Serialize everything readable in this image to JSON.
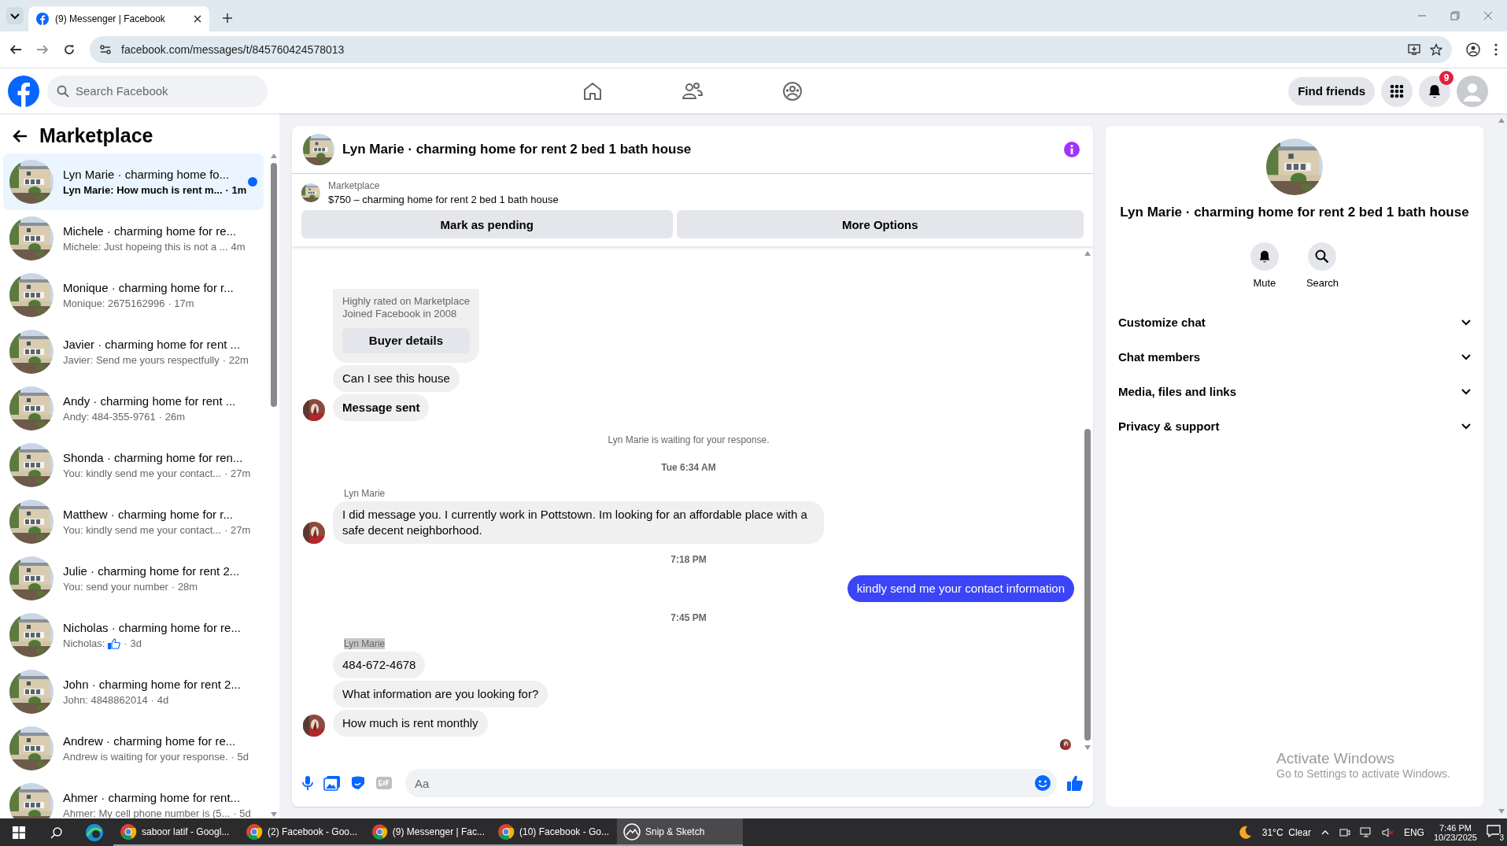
{
  "browser": {
    "tab_title": "(9) Messenger | Facebook",
    "url": "facebook.com/messages/t/845760424578013"
  },
  "header": {
    "search_placeholder": "Search Facebook",
    "find_friends": "Find friends",
    "notification_count": "9"
  },
  "sidebar": {
    "title": "Marketplace",
    "conversations": [
      {
        "title": "Lyn Marie · charming home fo...",
        "preview": "Lyn Marie: How much is rent m...",
        "time": "· 1m",
        "selected": true,
        "unread": true,
        "kind": "text"
      },
      {
        "title": "Michele · charming home for re...",
        "preview": "Michele: Just hopeing this is not a ...",
        "time": "4m",
        "selected": false,
        "unread": false,
        "kind": "text"
      },
      {
        "title": "Monique · charming home for r...",
        "preview": "Monique: 2675162996",
        "time": "· 17m",
        "selected": false,
        "unread": false,
        "kind": "text"
      },
      {
        "title": "Javier · charming home for rent ...",
        "preview": "Javier: Send me yours respectfully",
        "time": "· 22m",
        "selected": false,
        "unread": false,
        "kind": "text"
      },
      {
        "title": "Andy · charming home for rent ...",
        "preview": "Andy: 484-355-9761",
        "time": "· 26m",
        "selected": false,
        "unread": false,
        "kind": "text"
      },
      {
        "title": "Shonda · charming home for ren...",
        "preview": "You: kindly send me your contact...",
        "time": "· 27m",
        "selected": false,
        "unread": false,
        "kind": "text"
      },
      {
        "title": "Matthew · charming home for r...",
        "preview": "You: kindly send me your contact...",
        "time": "· 27m",
        "selected": false,
        "unread": false,
        "kind": "text"
      },
      {
        "title": "Julie · charming home for rent 2...",
        "preview": "You: send your number",
        "time": "· 28m",
        "selected": false,
        "unread": false,
        "kind": "text"
      },
      {
        "title": "Nicholas · charming home for re...",
        "preview": "Nicholas:",
        "time": "· 3d",
        "selected": false,
        "unread": false,
        "kind": "like"
      },
      {
        "title": "John · charming home for rent 2...",
        "preview": "John: 4848862014",
        "time": "· 4d",
        "selected": false,
        "unread": false,
        "kind": "text"
      },
      {
        "title": "Andrew · charming home for re...",
        "preview": "Andrew is waiting for your response.",
        "time": "· 5d",
        "selected": false,
        "unread": false,
        "kind": "text"
      },
      {
        "title": "Ahmer · charming home for rent...",
        "preview": "Ahmer: My cell phone number is (5...",
        "time": "· 5d",
        "selected": false,
        "unread": false,
        "kind": "text"
      }
    ]
  },
  "chat": {
    "title": "Lyn Marie · charming home for rent 2 bed 1 bath house",
    "listing": {
      "label": "Marketplace",
      "text": "$750 – charming home for rent 2 bed 1 bath house"
    },
    "actions": [
      "Mark as pending",
      "More Options"
    ],
    "messages": [
      {
        "kind": "card",
        "lines": [
          "Highly rated on Marketplace",
          "Joined Facebook in 2008"
        ],
        "button": "Buyer details"
      },
      {
        "kind": "in",
        "text": "Can I see this house",
        "avatar": false
      },
      {
        "kind": "sent_notice",
        "text": "Message sent",
        "avatar": true
      },
      {
        "kind": "notice",
        "text": "Lyn Marie is waiting for your response."
      },
      {
        "kind": "timestamp",
        "text": "Tue 6:34 AM"
      },
      {
        "kind": "sender",
        "text": "Lyn Marie",
        "highlighted": false
      },
      {
        "kind": "in",
        "text": "I did message you. I currently work in Pottstown. Im looking for an affordable place with a safe decent neighborhood.",
        "avatar": true
      },
      {
        "kind": "timestamp",
        "text": "7:18 PM"
      },
      {
        "kind": "out",
        "text": "kindly send me your contact information"
      },
      {
        "kind": "timestamp",
        "text": "7:45 PM"
      },
      {
        "kind": "sender",
        "text": "Lyn Marie",
        "highlighted": true
      },
      {
        "kind": "in",
        "text": "484-672-4678",
        "avatar": false
      },
      {
        "kind": "in",
        "text": "What information are you looking for?",
        "avatar": false
      },
      {
        "kind": "in",
        "text": "How much is rent monthly",
        "avatar": true
      }
    ],
    "composer": {
      "placeholder": "Aa"
    }
  },
  "details": {
    "title": "Lyn Marie · charming home for rent 2 bed 1 bath house",
    "actions": [
      {
        "label": "Mute",
        "kind": "mute"
      },
      {
        "label": "Search",
        "kind": "search"
      }
    ],
    "sections": [
      "Customize chat",
      "Chat members",
      "Media, files and links",
      "Privacy & support"
    ]
  },
  "activation": {
    "title": "Activate Windows",
    "text": "Go to Settings to activate Windows."
  },
  "taskbar": {
    "apps": [
      {
        "label": "saboor latif - Googl...",
        "kind": "chrome",
        "selected": false
      },
      {
        "label": "(2) Facebook - Goo...",
        "kind": "chrome",
        "selected": false
      },
      {
        "label": "(9) Messenger | Fac...",
        "kind": "chrome",
        "selected": false
      },
      {
        "label": "(10) Facebook - Go...",
        "kind": "chrome",
        "selected": false
      },
      {
        "label": "Snip & Sketch",
        "kind": "snip",
        "selected": true
      }
    ],
    "weather": "31°C  Clear",
    "language": "ENG",
    "time": "7:46 PM",
    "date": "10/23/2025",
    "notifications": "3"
  }
}
